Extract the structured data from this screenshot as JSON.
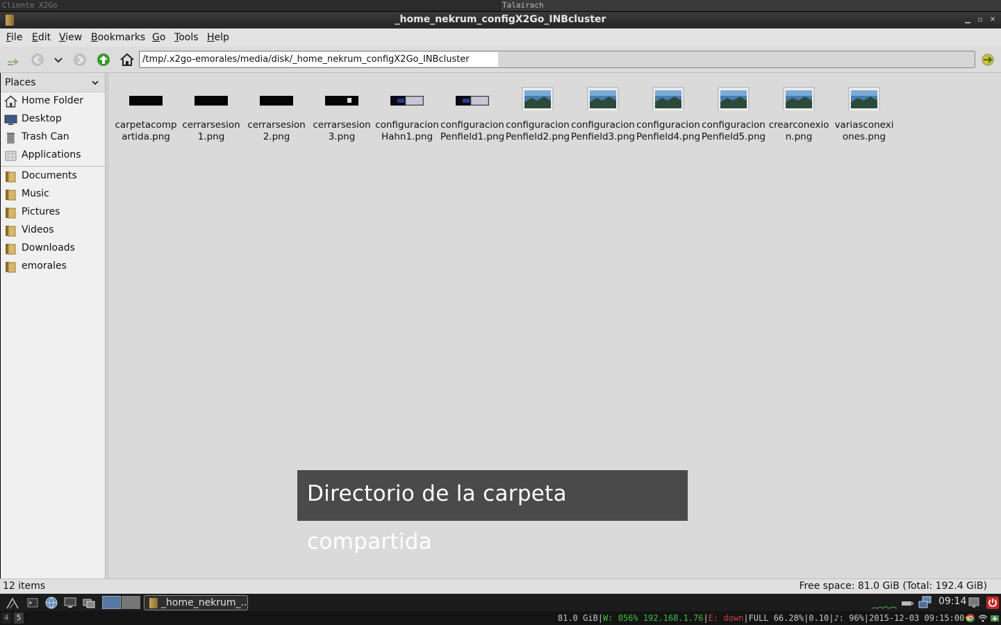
{
  "outer": {
    "left_title": "Cliente X2Go",
    "right_title": "Talairach"
  },
  "window": {
    "title": "_home_nekrum_configX2Go_INBcluster"
  },
  "menu": [
    {
      "label": "File"
    },
    {
      "label": "Edit"
    },
    {
      "label": "View"
    },
    {
      "label": "Bookmarks"
    },
    {
      "label": "Go"
    },
    {
      "label": "Tools"
    },
    {
      "label": "Help"
    }
  ],
  "toolbar": {
    "path": "/tmp/.x2go-emorales/media/disk/_home_nekrum_configX2Go_INBcluster"
  },
  "sidebar": {
    "header": "Places",
    "places": [
      {
        "label": "Home Folder",
        "icon": "home-icon"
      },
      {
        "label": "Desktop",
        "icon": "desktop-icon"
      },
      {
        "label": "Trash Can",
        "icon": "trash-icon"
      },
      {
        "label": "Applications",
        "icon": "applications-icon"
      }
    ],
    "bookmarks": [
      {
        "label": "Documents",
        "icon": "folder-icon"
      },
      {
        "label": "Music",
        "icon": "folder-icon"
      },
      {
        "label": "Pictures",
        "icon": "folder-icon"
      },
      {
        "label": "Videos",
        "icon": "folder-icon"
      },
      {
        "label": "Downloads",
        "icon": "folder-icon"
      },
      {
        "label": "emorales",
        "icon": "folder-icon"
      }
    ]
  },
  "files": [
    {
      "name": "carpetacomp\nartida.png",
      "thumb": "dark"
    },
    {
      "name": "cerrarsesion\n1.png",
      "thumb": "dark"
    },
    {
      "name": "cerrarsesion\n2.png",
      "thumb": "dark"
    },
    {
      "name": "cerrarsesion\n3.png",
      "thumb": "dark-dialog"
    },
    {
      "name": "configuracion\nHahn1.png",
      "thumb": "dark-window"
    },
    {
      "name": "configuracion\nPenfield1.png",
      "thumb": "dark-window"
    },
    {
      "name": "configuracion\nPenfield2.png",
      "thumb": "landscape"
    },
    {
      "name": "configuracion\nPenfield3.png",
      "thumb": "landscape"
    },
    {
      "name": "configuracion\nPenfield4.png",
      "thumb": "landscape"
    },
    {
      "name": "configuracion\nPenfield5.png",
      "thumb": "landscape"
    },
    {
      "name": "crearconexio\nn.png",
      "thumb": "landscape"
    },
    {
      "name": "variasconexi\nones.png",
      "thumb": "landscape"
    }
  ],
  "caption": "Directorio de la carpeta compartida",
  "status": {
    "count": "12 items",
    "free": "Free space: 81.0 GiB (Total: 192.4 GiB)"
  },
  "taskbar": {
    "window_label": "_home_nekrum_...",
    "clock": "09:14"
  },
  "workspaces": [
    "4",
    "5"
  ],
  "stats": {
    "disk": "81.0 GiB",
    "sep1": "|",
    "wifi": "W: 056% 192.168.1.76",
    "sep2": "|",
    "eth": "E: down",
    "sep3": "|",
    "battery": "FULL 66.28%",
    "sep4": "|",
    "load": "0.10",
    "sep5": "|",
    "volume": "♪: 96%",
    "sep6": "|",
    "datetime": "2015-12-03 09:15:00"
  },
  "colors": {
    "good": "#3fbf3f",
    "bad": "#d23c3c",
    "folder": "#c9a55a",
    "go_arrow": "#3a9a2a"
  }
}
